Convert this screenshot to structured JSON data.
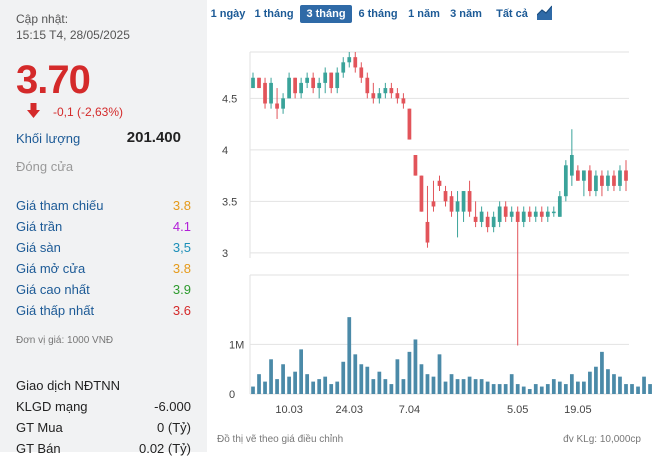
{
  "sidebar": {
    "updated_label": "Cập nhật:",
    "updated_time": "15:15 T4, 28/05/2025",
    "price": "3.70",
    "change": "-0,1 (-2,63%)",
    "volume_label": "Khối lượng",
    "volume_value": "201.400",
    "close_label": "Đóng cửa",
    "stats": [
      {
        "label": "Giá tham chiếu",
        "value": "3.8",
        "color": "#e59a1a"
      },
      {
        "label": "Giá trần",
        "value": "4.1",
        "color": "#b21fd8"
      },
      {
        "label": "Giá sàn",
        "value": "3,5",
        "color": "#1c8fb8"
      },
      {
        "label": "Giá mở cửa",
        "value": "3.8",
        "color": "#e59a1a"
      },
      {
        "label": "Giá cao nhất",
        "value": "3.9",
        "color": "#2d9a2d"
      },
      {
        "label": "Giá thấp nhất",
        "value": "3.6",
        "color": "#d42a2a"
      }
    ],
    "unit_note": "Đơn vị giá: 1000 VNĐ",
    "foreign": {
      "title": "Giao dịch NĐTNN",
      "rows": [
        {
          "label": "KLGD mạng",
          "value": "-6.000"
        },
        {
          "label": "GT Mua",
          "value": "0 (Tỷ)"
        },
        {
          "label": "GT Bán",
          "value": "0.02 (Tỷ)"
        }
      ]
    }
  },
  "tabs": [
    {
      "label": "1 ngày",
      "active": false
    },
    {
      "label": "1 tháng",
      "active": false
    },
    {
      "label": "3 tháng",
      "active": true
    },
    {
      "label": "6 tháng",
      "active": false
    },
    {
      "label": "1 năm",
      "active": false
    },
    {
      "label": "3 năm",
      "active": false
    },
    {
      "label": "Tất cả",
      "active": false
    }
  ],
  "notes": {
    "left": "Đồ thị vẽ theo giá điều chỉnh",
    "right": "đv KLg: 10,000cp"
  },
  "colors": {
    "up": "#3aa39a",
    "down": "#e2545a",
    "volume": "#4b8aa8",
    "grid": "#e2e2e2"
  },
  "chart_data": [
    {
      "type": "candlestick",
      "price_ticks": [
        "4.5",
        "4",
        "3.5",
        "3"
      ],
      "price_tick_values": [
        4.5,
        4,
        3.5,
        3
      ],
      "ylim": [
        2.95,
        4.95
      ],
      "date_ticks": [
        {
          "label": "10.03",
          "index": 6
        },
        {
          "label": "24.03",
          "index": 16
        },
        {
          "label": "7.04",
          "index": 26
        },
        {
          "label": "5.05",
          "index": 44
        },
        {
          "label": "19.05",
          "index": 54
        }
      ],
      "candles": [
        [
          4.6,
          4.75,
          4.6,
          4.7
        ],
        [
          4.7,
          4.7,
          4.6,
          4.6
        ],
        [
          4.65,
          4.7,
          4.4,
          4.45
        ],
        [
          4.45,
          4.7,
          4.4,
          4.65
        ],
        [
          4.45,
          4.6,
          4.3,
          4.4
        ],
        [
          4.4,
          4.55,
          4.35,
          4.5
        ],
        [
          4.5,
          4.75,
          4.5,
          4.7
        ],
        [
          4.7,
          4.7,
          4.5,
          4.55
        ],
        [
          4.55,
          4.7,
          4.5,
          4.65
        ],
        [
          4.65,
          4.75,
          4.6,
          4.7
        ],
        [
          4.7,
          4.75,
          4.55,
          4.6
        ],
        [
          4.6,
          4.7,
          4.5,
          4.65
        ],
        [
          4.65,
          4.8,
          4.55,
          4.75
        ],
        [
          4.75,
          4.75,
          4.55,
          4.6
        ],
        [
          4.6,
          4.8,
          4.55,
          4.75
        ],
        [
          4.75,
          4.9,
          4.7,
          4.85
        ],
        [
          4.85,
          4.95,
          4.8,
          4.9
        ],
        [
          4.9,
          4.95,
          4.75,
          4.8
        ],
        [
          4.8,
          4.85,
          4.65,
          4.7
        ],
        [
          4.7,
          4.75,
          4.5,
          4.55
        ],
        [
          4.55,
          4.65,
          4.45,
          4.5
        ],
        [
          4.5,
          4.6,
          4.45,
          4.55
        ],
        [
          4.55,
          4.65,
          4.5,
          4.6
        ],
        [
          4.6,
          4.65,
          4.5,
          4.55
        ],
        [
          4.55,
          4.6,
          4.45,
          4.5
        ],
        [
          4.5,
          4.55,
          4.4,
          4.45
        ],
        [
          4.4,
          4.4,
          4.1,
          4.1
        ],
        [
          3.95,
          3.95,
          3.75,
          3.75
        ],
        [
          3.75,
          3.75,
          3.4,
          3.4
        ],
        [
          3.3,
          3.65,
          3.05,
          3.1
        ],
        [
          3.5,
          3.7,
          3.4,
          3.45
        ],
        [
          3.7,
          3.75,
          3.6,
          3.65
        ],
        [
          3.6,
          3.65,
          3.45,
          3.5
        ],
        [
          3.55,
          3.6,
          3.35,
          3.4
        ],
        [
          3.4,
          3.6,
          3.15,
          3.5
        ],
        [
          3.4,
          3.6,
          3.3,
          3.6
        ],
        [
          3.6,
          3.7,
          3.35,
          3.4
        ],
        [
          3.35,
          3.5,
          3.25,
          3.3
        ],
        [
          3.3,
          3.45,
          3.25,
          3.4
        ],
        [
          3.35,
          3.4,
          3.2,
          3.25
        ],
        [
          3.25,
          3.4,
          3.2,
          3.35
        ],
        [
          3.3,
          3.5,
          3.25,
          3.45
        ],
        [
          3.45,
          3.5,
          3.3,
          3.35
        ],
        [
          3.35,
          3.45,
          3.3,
          3.4
        ],
        [
          3.4,
          3.45,
          2.1,
          3.3
        ],
        [
          3.3,
          3.45,
          3.25,
          3.4
        ],
        [
          3.4,
          3.45,
          3.3,
          3.35
        ],
        [
          3.35,
          3.45,
          3.3,
          3.4
        ],
        [
          3.4,
          3.45,
          3.3,
          3.35
        ],
        [
          3.35,
          3.45,
          3.3,
          3.4
        ],
        [
          3.4,
          3.45,
          3.35,
          3.4
        ],
        [
          3.35,
          3.6,
          3.35,
          3.55
        ],
        [
          3.55,
          3.9,
          3.5,
          3.85
        ],
        [
          3.75,
          4.2,
          3.65,
          3.95
        ],
        [
          3.8,
          3.85,
          3.7,
          3.7
        ],
        [
          3.7,
          3.8,
          3.55,
          3.8
        ],
        [
          3.8,
          3.85,
          3.55,
          3.6
        ],
        [
          3.6,
          3.8,
          3.55,
          3.75
        ],
        [
          3.75,
          3.8,
          3.55,
          3.65
        ],
        [
          3.65,
          3.8,
          3.6,
          3.75
        ],
        [
          3.75,
          3.8,
          3.6,
          3.65
        ],
        [
          3.65,
          3.85,
          3.6,
          3.8
        ],
        [
          3.8,
          3.9,
          3.6,
          3.7
        ]
      ]
    },
    {
      "type": "bar",
      "ticks": [
        "1M",
        "0"
      ],
      "tick_values": [
        100,
        0
      ],
      "ylim": [
        0,
        240
      ],
      "volumes": [
        15,
        40,
        25,
        70,
        30,
        60,
        35,
        45,
        90,
        40,
        25,
        30,
        35,
        20,
        25,
        65,
        155,
        80,
        60,
        55,
        30,
        45,
        30,
        20,
        70,
        30,
        85,
        110,
        60,
        40,
        35,
        80,
        25,
        40,
        30,
        30,
        35,
        30,
        30,
        25,
        20,
        20,
        20,
        40,
        20,
        15,
        10,
        20,
        15,
        20,
        30,
        25,
        20,
        40,
        25,
        25,
        45,
        55,
        85,
        50,
        40,
        35,
        20,
        20,
        15,
        35,
        20
      ]
    }
  ]
}
